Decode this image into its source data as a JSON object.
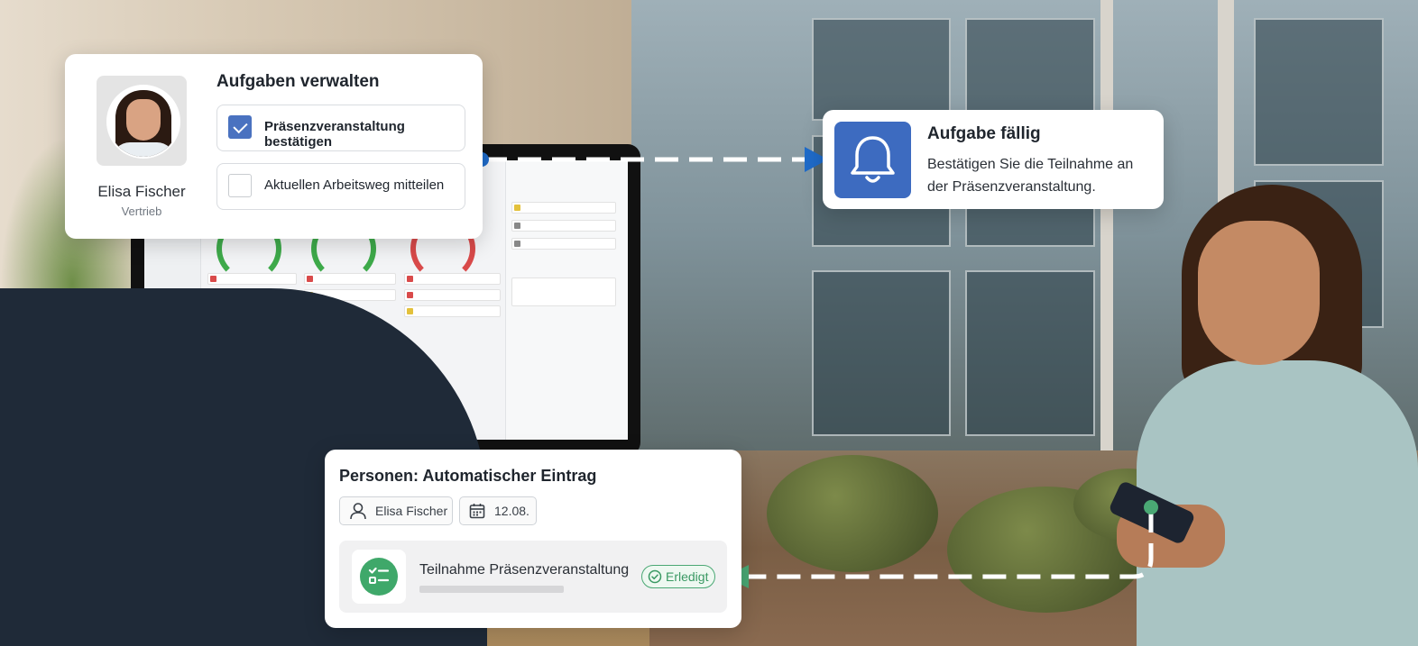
{
  "profile_card": {
    "name": "Elisa Fischer",
    "department": "Vertrieb",
    "title": "Aufgaben verwalten",
    "tasks": [
      {
        "label": "Präsenzveranstaltung bestätigen",
        "checked": true
      },
      {
        "label": "Aktuellen Arbeitsweg mitteilen",
        "checked": false
      }
    ]
  },
  "notification": {
    "title": "Aufgabe fällig",
    "text": "Bestätigen Sie die Teilnahme an der Präsenzveranstaltung.",
    "icon": "bell-icon",
    "color": "#3d6bc0"
  },
  "entry_card": {
    "title": "Personen: Automatischer Eintrag",
    "person_chip": "Elisa Fischer",
    "date_chip": "12.08.",
    "entry_label": "Teilnahme Präsenzveranstaltung",
    "status_badge": "Erledigt",
    "status_color": "#3a9963"
  },
  "colors": {
    "accent_blue": "#3d6bc0",
    "success_green": "#3fa86a"
  }
}
